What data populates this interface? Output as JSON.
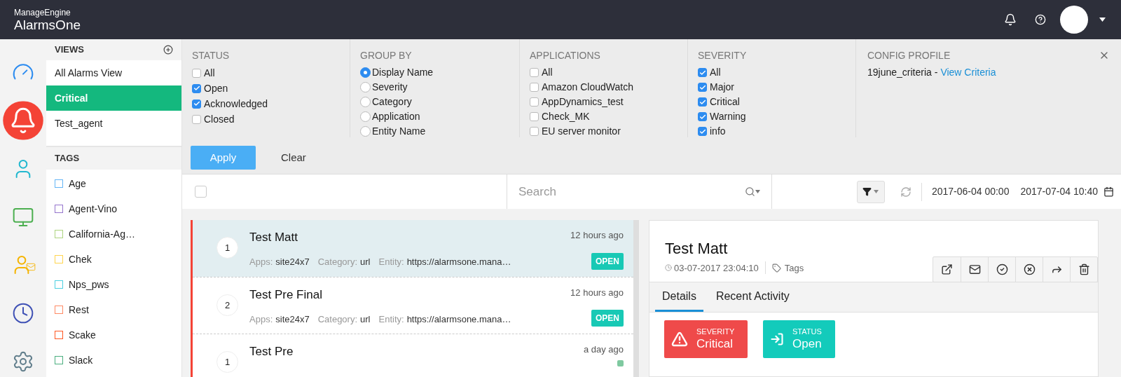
{
  "header": {
    "brand_top": "ManageEngine",
    "brand": "AlarmsOne"
  },
  "rail": [
    {
      "kind": "dashboard",
      "selected": false
    },
    {
      "kind": "alarms",
      "selected": true
    },
    {
      "kind": "users",
      "selected": false
    },
    {
      "kind": "monitor",
      "selected": false
    },
    {
      "kind": "contacts",
      "selected": false
    },
    {
      "kind": "history",
      "selected": false
    },
    {
      "kind": "settings",
      "selected": false
    }
  ],
  "views": {
    "title": "VIEWS",
    "items": [
      {
        "label": "All Alarms View",
        "selected": false
      },
      {
        "label": "Critical",
        "selected": true
      },
      {
        "label": "Test_agent",
        "selected": false
      }
    ]
  },
  "tags": {
    "title": "TAGS",
    "items": [
      {
        "label": "Age",
        "color": "#64b5f6"
      },
      {
        "label": "Agent-Vino",
        "color": "#9575cd"
      },
      {
        "label": "California-Ag…",
        "color": "#aed581"
      },
      {
        "label": "Chek",
        "color": "#ffd54f"
      },
      {
        "label": "Nps_pws",
        "color": "#4dd0e1"
      },
      {
        "label": "Rest",
        "color": "#ff8a65"
      },
      {
        "label": "Scake",
        "color": "#ff5722"
      },
      {
        "label": "Slack",
        "color": "#4caf80"
      }
    ]
  },
  "filters": {
    "status": {
      "title": "STATUS",
      "options": [
        {
          "label": "All",
          "checked": false
        },
        {
          "label": "Open",
          "checked": true
        },
        {
          "label": "Acknowledged",
          "checked": true
        },
        {
          "label": "Closed",
          "checked": false
        }
      ]
    },
    "group_by": {
      "title": "GROUP BY",
      "options": [
        {
          "label": "Display Name",
          "selected": true
        },
        {
          "label": "Severity",
          "selected": false
        },
        {
          "label": "Category",
          "selected": false
        },
        {
          "label": "Application",
          "selected": false
        },
        {
          "label": "Entity Name",
          "selected": false
        }
      ]
    },
    "applications": {
      "title": "APPLICATIONS",
      "options": [
        {
          "label": "All",
          "checked": false
        },
        {
          "label": "Amazon CloudWatch",
          "checked": false
        },
        {
          "label": "AppDynamics_test",
          "checked": false
        },
        {
          "label": "Check_MK",
          "checked": false
        },
        {
          "label": "EU server monitor",
          "checked": false
        }
      ]
    },
    "severity": {
      "title": "SEVERITY",
      "options": [
        {
          "label": "All",
          "checked": true
        },
        {
          "label": "Major",
          "checked": true
        },
        {
          "label": "Critical",
          "checked": true
        },
        {
          "label": "Warning",
          "checked": true
        },
        {
          "label": "info",
          "checked": true
        }
      ]
    },
    "config_profile": {
      "title": "CONFIG PROFILE",
      "name": "19june_criteria -",
      "link": "View Criteria"
    },
    "apply": "Apply",
    "clear": "Clear"
  },
  "toolbar": {
    "select_all_checked": false,
    "search_placeholder": "Search",
    "date_from": "2017-06-04 00:00",
    "date_to": "2017-07-04 10:40"
  },
  "alarms": [
    {
      "count": "1",
      "title": "Test Matt",
      "time": "12 hours ago",
      "apps_label": "Apps:",
      "apps": "site24x7",
      "category_label": "Category:",
      "category": "url",
      "entity_label": "Entity:",
      "entity": "https://alarmsone.mana…",
      "badge": {
        "kind": "label",
        "text": "OPEN"
      },
      "selected": true
    },
    {
      "count": "2",
      "title": "Test Pre Final",
      "time": "12 hours ago",
      "apps_label": "Apps:",
      "apps": "site24x7",
      "category_label": "Category:",
      "category": "url",
      "entity_label": "Entity:",
      "entity": "https://alarmsone.mana…",
      "badge": {
        "kind": "label",
        "text": "OPEN"
      },
      "selected": false
    },
    {
      "count": "1",
      "title": "Test Pre",
      "time": "a day ago",
      "badge": {
        "kind": "dot",
        "color": "#7fc9a0"
      },
      "selected": false
    }
  ],
  "detail": {
    "title": "Test Matt",
    "timestamp": "03-07-2017 23:04:10",
    "tags_label": "Tags",
    "actions": [
      {
        "kind": "open"
      },
      {
        "kind": "email"
      },
      {
        "kind": "acknowledge"
      },
      {
        "kind": "close"
      },
      {
        "kind": "forward"
      },
      {
        "kind": "delete"
      }
    ],
    "tabs": [
      {
        "label": "Details",
        "selected": true
      },
      {
        "label": "Recent Activity",
        "selected": false
      }
    ],
    "cards": [
      {
        "kind": "severity",
        "label": "SEVERITY",
        "value": "Critical"
      },
      {
        "kind": "status",
        "label": "STATUS",
        "value": "Open"
      }
    ]
  }
}
